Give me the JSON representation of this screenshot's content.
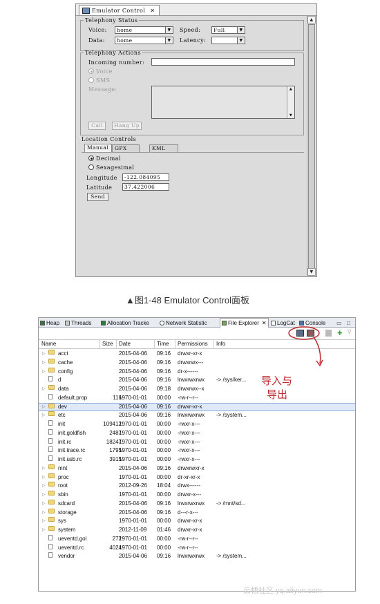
{
  "emulator": {
    "tab_title": "Emulator Control",
    "telephony_status": {
      "legend": "Telephony Status",
      "voice_label": "Voice:",
      "voice_value": "home",
      "speed_label": "Speed:",
      "speed_value": "Full",
      "data_label": "Data:",
      "data_value": "home",
      "latency_label": "Latency:",
      "latency_value": ""
    },
    "telephony_actions": {
      "legend": "Telephony Actions",
      "incoming_label": "Incoming number:",
      "incoming_value": "",
      "voice_radio": "Voice",
      "sms_radio": "SMS",
      "message_label": "Message:",
      "call_button": "Call",
      "hangup_button": "Hang Up"
    },
    "location": {
      "title": "Location Controls",
      "tabs": [
        "Manual",
        "GPX",
        "KML"
      ],
      "decimal_radio": "Decimal",
      "sexagesimal_radio": "Sexagesimal",
      "longitude_label": "Longitude",
      "longitude_value": "-122.084095",
      "latitude_label": "Latitude",
      "latitude_value": "37.422006",
      "send_button": "Send"
    }
  },
  "caption1": "▲图1-48 Emulator Control面板",
  "explorer": {
    "tabs": [
      "Heap",
      "Threads",
      "Allocation Tracke",
      "Network Statistic",
      "File Explorer",
      "LogCat",
      "Console"
    ],
    "active_tab": "File Explorer",
    "columns": [
      "Name",
      "Size",
      "Date",
      "Time",
      "Permissions",
      "Info"
    ],
    "rows": [
      {
        "name": "acct",
        "type": "folder",
        "size": "",
        "date": "2015-04-06",
        "time": "09:16",
        "perm": "drwxr-xr-x",
        "info": ""
      },
      {
        "name": "cache",
        "type": "folder",
        "size": "",
        "date": "2015-04-06",
        "time": "09:16",
        "perm": "drwxrwx---",
        "info": ""
      },
      {
        "name": "config",
        "type": "folder",
        "size": "",
        "date": "2015-04-06",
        "time": "09:16",
        "perm": "dr-x------",
        "info": ""
      },
      {
        "name": "d",
        "type": "file",
        "size": "",
        "date": "2015-04-06",
        "time": "09:16",
        "perm": "lrwxrwxrwx",
        "info": "-> /sys/ker..."
      },
      {
        "name": "data",
        "type": "folder",
        "size": "",
        "date": "2015-04-06",
        "time": "09:18",
        "perm": "drwxrwx--x",
        "info": ""
      },
      {
        "name": "default.prop",
        "type": "file",
        "size": "116",
        "date": "1970-01-01",
        "time": "00:00",
        "perm": "-rw-r--r--",
        "info": ""
      },
      {
        "name": "dev",
        "type": "folder",
        "size": "",
        "date": "2015-04-06",
        "time": "09:16",
        "perm": "drwxr-xr-x",
        "info": ""
      },
      {
        "name": "etc",
        "type": "folder",
        "size": "",
        "date": "2015-04-06",
        "time": "09:16",
        "perm": "lrwxrwxrwx",
        "info": "-> /system..."
      },
      {
        "name": "init",
        "type": "file",
        "size": "109412",
        "date": "1970-01-01",
        "time": "00:00",
        "perm": "-rwxr-x---",
        "info": ""
      },
      {
        "name": "init.goldfish",
        "type": "file",
        "size": "2487",
        "date": "1970-01-01",
        "time": "00:00",
        "perm": "-rwxr-x---",
        "info": ""
      },
      {
        "name": "init.rc",
        "type": "file",
        "size": "18247",
        "date": "1970-01-01",
        "time": "00:00",
        "perm": "-rwxr-x---",
        "info": ""
      },
      {
        "name": "init.trace.rc",
        "type": "file",
        "size": "1795",
        "date": "1970-01-01",
        "time": "00:00",
        "perm": "-rwxr-x---",
        "info": ""
      },
      {
        "name": "init.usb.rc",
        "type": "file",
        "size": "3915",
        "date": "1970-01-01",
        "time": "00:00",
        "perm": "-rwxr-x---",
        "info": ""
      },
      {
        "name": "mnt",
        "type": "folder",
        "size": "",
        "date": "2015-04-06",
        "time": "09:16",
        "perm": "drwxrwxr-x",
        "info": ""
      },
      {
        "name": "proc",
        "type": "folder",
        "size": "",
        "date": "1970-01-01",
        "time": "00:00",
        "perm": "dr-xr-xr-x",
        "info": ""
      },
      {
        "name": "root",
        "type": "folder",
        "size": "",
        "date": "2012-09-26",
        "time": "18:04",
        "perm": "drwx------",
        "info": ""
      },
      {
        "name": "sbin",
        "type": "folder",
        "size": "",
        "date": "1970-01-01",
        "time": "00:00",
        "perm": "drwxr-x---",
        "info": ""
      },
      {
        "name": "sdcard",
        "type": "folder",
        "size": "",
        "date": "2015-04-06",
        "time": "09:16",
        "perm": "lrwxrwxrwx",
        "info": "-> /mnt/sd..."
      },
      {
        "name": "storage",
        "type": "folder",
        "size": "",
        "date": "2015-04-06",
        "time": "09:16",
        "perm": "d---r-x---",
        "info": ""
      },
      {
        "name": "sys",
        "type": "folder",
        "size": "",
        "date": "1970-01-01",
        "time": "00:00",
        "perm": "drwxr-xr-x",
        "info": ""
      },
      {
        "name": "system",
        "type": "folder",
        "size": "",
        "date": "2012-11-09",
        "time": "01:46",
        "perm": "drwxr-xr-x",
        "info": ""
      },
      {
        "name": "ueventd.goldfish.rc",
        "display": "ueventd.gol",
        "type": "file",
        "size": "272",
        "date": "1970-01-01",
        "time": "00:00",
        "perm": "-rw-r--r--",
        "info": ""
      },
      {
        "name": "ueventd.rc",
        "type": "file",
        "size": "4024",
        "date": "1970-01-01",
        "time": "00:00",
        "perm": "-rw-r--r--",
        "info": ""
      },
      {
        "name": "vendor",
        "type": "file",
        "size": "",
        "date": "2015-04-06",
        "time": "09:16",
        "perm": "lrwxrwxrwx",
        "info": "-> /system..."
      }
    ],
    "selected_row": "dev"
  },
  "annotation": {
    "line1": "导入与",
    "line2": "导出",
    "color": "#c0282c"
  },
  "watermark": "云栖社区 yq.aliyun.com"
}
